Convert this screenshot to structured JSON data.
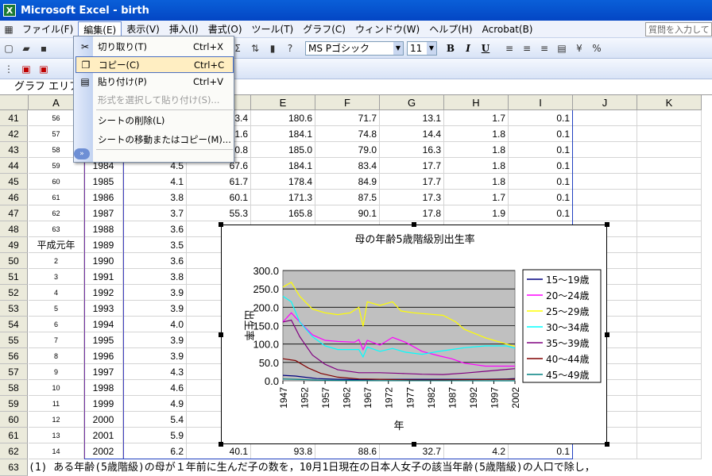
{
  "window": {
    "title": "Microsoft Excel - birth",
    "app_icon": "excel-icon"
  },
  "menubar": {
    "items": [
      "ファイル(F)",
      "編集(E)",
      "表示(V)",
      "挿入(I)",
      "書式(O)",
      "ツール(T)",
      "グラフ(C)",
      "ウィンドウ(W)",
      "ヘルプ(H)",
      "Acrobat(B)"
    ],
    "active_index": 1,
    "help_placeholder": "質問を入力して"
  },
  "toolbar": {
    "font_name": "MS Pゴシック",
    "font_size": "11",
    "bold": "B",
    "italic": "I",
    "underline": "U",
    "sigma": "Σ"
  },
  "name_box": "グラフ エリア",
  "columns": [
    "A",
    "B",
    "C",
    "D",
    "E",
    "F",
    "G",
    "H",
    "I",
    "J",
    "K"
  ],
  "context_menu": {
    "items": [
      {
        "label": "切り取り(T)",
        "shortcut": "Ctrl+X",
        "icon": "scissors-icon",
        "state": "normal"
      },
      {
        "label": "コピー(C)",
        "shortcut": "Ctrl+C",
        "icon": "copy-icon",
        "state": "highlighted"
      },
      {
        "label": "貼り付け(P)",
        "shortcut": "Ctrl+V",
        "icon": "paste-icon",
        "state": "normal"
      },
      {
        "label": "形式を選択して貼り付け(S)...",
        "shortcut": "",
        "icon": "",
        "state": "disabled"
      },
      {
        "label": "シートの削除(L)",
        "shortcut": "",
        "icon": "",
        "state": "normal"
      },
      {
        "label": "シートの移動またはコピー(M)...",
        "shortcut": "",
        "icon": "",
        "state": "normal"
      }
    ],
    "expand_icon": "expand-chevron-icon"
  },
  "rows": [
    {
      "n": "41",
      "A": "56",
      "B": "",
      "C": "",
      "D": "3.4",
      "E": "180.6",
      "F": "71.7",
      "G": "13.1",
      "H": "1.7",
      "I": "0.1"
    },
    {
      "n": "42",
      "A": "57",
      "B": "",
      "C": "",
      "D": "1.6",
      "E": "184.1",
      "F": "74.8",
      "G": "14.4",
      "H": "1.8",
      "I": "0.1"
    },
    {
      "n": "43",
      "A": "58",
      "B": "",
      "C": "",
      "D": "0.8",
      "E": "185.0",
      "F": "79.0",
      "G": "16.3",
      "H": "1.8",
      "I": "0.1"
    },
    {
      "n": "44",
      "A": "59",
      "B": "1984",
      "C": "4.5",
      "D": "67.6",
      "E": "184.1",
      "F": "83.4",
      "G": "17.7",
      "H": "1.8",
      "I": "0.1"
    },
    {
      "n": "45",
      "A": "60",
      "B": "1985",
      "C": "4.1",
      "D": "61.7",
      "E": "178.4",
      "F": "84.9",
      "G": "17.7",
      "H": "1.8",
      "I": "0.1"
    },
    {
      "n": "46",
      "A": "61",
      "B": "1986",
      "C": "3.8",
      "D": "60.1",
      "E": "171.3",
      "F": "87.5",
      "G": "17.3",
      "H": "1.7",
      "I": "0.1"
    },
    {
      "n": "47",
      "A": "62",
      "B": "1987",
      "C": "3.7",
      "D": "55.3",
      "E": "165.8",
      "F": "90.1",
      "G": "17.8",
      "H": "1.9",
      "I": "0.1"
    },
    {
      "n": "48",
      "A": "63",
      "B": "1988",
      "C": "3.6"
    },
    {
      "n": "49",
      "A": "平成元年",
      "B": "1989",
      "C": "3.5"
    },
    {
      "n": "50",
      "A": "2",
      "B": "1990",
      "C": "3.6"
    },
    {
      "n": "51",
      "A": "3",
      "B": "1991",
      "C": "3.8"
    },
    {
      "n": "52",
      "A": "4",
      "B": "1992",
      "C": "3.9"
    },
    {
      "n": "53",
      "A": "5",
      "B": "1993",
      "C": "3.9"
    },
    {
      "n": "54",
      "A": "6",
      "B": "1994",
      "C": "4.0"
    },
    {
      "n": "55",
      "A": "7",
      "B": "1995",
      "C": "3.9"
    },
    {
      "n": "56",
      "A": "8",
      "B": "1996",
      "C": "3.9"
    },
    {
      "n": "57",
      "A": "9",
      "B": "1997",
      "C": "4.3"
    },
    {
      "n": "58",
      "A": "10",
      "B": "1998",
      "C": "4.6"
    },
    {
      "n": "59",
      "A": "11",
      "B": "1999",
      "C": "4.9"
    },
    {
      "n": "60",
      "A": "12",
      "B": "2000",
      "C": "5.4"
    },
    {
      "n": "61",
      "A": "13",
      "B": "2001",
      "C": "5.9"
    },
    {
      "n": "62",
      "A": "14",
      "B": "2002",
      "C": "6.2",
      "D": "40.1",
      "E": "93.8",
      "F": "88.6",
      "G": "32.7",
      "H": "4.2",
      "I": "0.1"
    }
  ],
  "note_row": {
    "n": "63",
    "text": "(1) ある年齢(5歳階級)の母が１年前に生んだ子の数を，10月1日現在の日本人女子の該当年齢(5歳階級)の人口で除し，"
  },
  "chart_data": {
    "type": "line",
    "title": "母の年齢5歳階級別出生率",
    "xlabel": "年",
    "ylabel": "出生率",
    "ylim": [
      0,
      300
    ],
    "yticks": [
      "0.0",
      "50.0",
      "100.0",
      "150.0",
      "200.0",
      "250.0",
      "300.0"
    ],
    "xticks": [
      "1947",
      "1952",
      "1957",
      "1962",
      "1967",
      "1972",
      "1977",
      "1982",
      "1987",
      "1992",
      "1997",
      "2002"
    ],
    "plot_bg": "#c0c0c0",
    "grid": true,
    "legend_position": "right",
    "series": [
      {
        "name": "15～19歳",
        "color": "#000080",
        "x": [
          1947,
          1950,
          1955,
          1960,
          1966,
          1970,
          1975,
          1980,
          1985,
          1990,
          1995,
          2000,
          2002
        ],
        "y": [
          15,
          13,
          6,
          4,
          3,
          4,
          4,
          4,
          4,
          4,
          4,
          5,
          6
        ]
      },
      {
        "name": "20～24歳",
        "color": "#ff00ff",
        "x": [
          1947,
          1949,
          1951,
          1954,
          1957,
          1960,
          1964,
          1965,
          1966,
          1967,
          1970,
          1973,
          1976,
          1980,
          1984,
          1987,
          1990,
          1995,
          2000,
          2002
        ],
        "y": [
          160,
          185,
          160,
          125,
          110,
          107,
          105,
          112,
          85,
          110,
          97,
          118,
          105,
          80,
          68,
          60,
          48,
          40,
          40,
          40
        ]
      },
      {
        "name": "25～29歳",
        "color": "#ffff00",
        "x": [
          1947,
          1949,
          1951,
          1954,
          1957,
          1960,
          1963,
          1965,
          1966,
          1967,
          1970,
          1973,
          1975,
          1978,
          1981,
          1985,
          1988,
          1990,
          1995,
          2000,
          2002
        ],
        "y": [
          255,
          268,
          230,
          195,
          185,
          180,
          185,
          200,
          148,
          215,
          205,
          215,
          190,
          185,
          182,
          178,
          160,
          140,
          117,
          100,
          94
        ]
      },
      {
        "name": "30～34歳",
        "color": "#00ffff",
        "x": [
          1947,
          1949,
          1951,
          1954,
          1957,
          1960,
          1965,
          1966,
          1967,
          1970,
          1973,
          1976,
          1980,
          1984,
          1987,
          1990,
          1995,
          2000,
          2002
        ],
        "y": [
          230,
          215,
          160,
          120,
          95,
          85,
          85,
          65,
          92,
          80,
          88,
          78,
          72,
          80,
          85,
          90,
          95,
          95,
          89
        ]
      },
      {
        "name": "35～39歳",
        "color": "#800080",
        "x": [
          1947,
          1949,
          1951,
          1954,
          1957,
          1960,
          1965,
          1970,
          1975,
          1980,
          1985,
          1990,
          1995,
          2000,
          2002
        ],
        "y": [
          160,
          165,
          120,
          70,
          45,
          30,
          22,
          22,
          20,
          18,
          17,
          21,
          26,
          31,
          33
        ]
      },
      {
        "name": "40～44歳",
        "color": "#800000",
        "x": [
          1947,
          1950,
          1953,
          1956,
          1960,
          1965,
          1970,
          1980,
          1990,
          2002
        ],
        "y": [
          60,
          55,
          35,
          20,
          10,
          5,
          4,
          2,
          3,
          4
        ]
      },
      {
        "name": "45～49歳",
        "color": "#008080",
        "x": [
          1947,
          1950,
          1955,
          1960,
          1970,
          2002
        ],
        "y": [
          5,
          4,
          2,
          1,
          0.5,
          0.1
        ]
      }
    ]
  }
}
